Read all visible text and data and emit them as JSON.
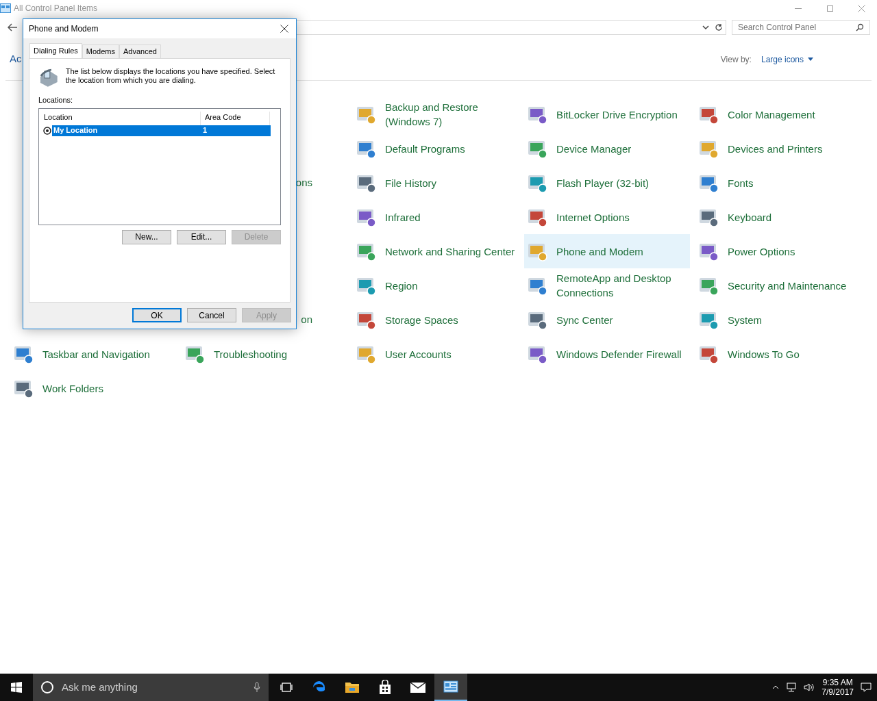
{
  "window": {
    "title": "All Control Panel Items",
    "search": {
      "placeholder": "Search Control Panel"
    },
    "heading": "Ac",
    "view_by": {
      "label": "View by:",
      "value": "Large icons"
    }
  },
  "rows": [
    [
      null,
      null,
      {
        "kind": "applet",
        "label": "Backup and Restore (Windows 7)",
        "highlighted": false
      },
      {
        "kind": "applet",
        "label": "BitLocker Drive Encryption",
        "highlighted": false
      },
      {
        "kind": "applet",
        "label": "Color Management",
        "highlighted": false
      }
    ],
    [
      null,
      null,
      {
        "kind": "applet",
        "label": "Default Programs",
        "highlighted": false
      },
      {
        "kind": "applet",
        "label": "Device Manager",
        "highlighted": false
      },
      {
        "kind": "applet",
        "label": "Devices and Printers",
        "highlighted": false
      }
    ],
    [
      null,
      {
        "kind": "clipped",
        "label": "ons"
      },
      {
        "kind": "applet",
        "label": "File History",
        "highlighted": false
      },
      {
        "kind": "applet",
        "label": "Flash Player (32-bit)",
        "highlighted": false
      },
      {
        "kind": "applet",
        "label": "Fonts",
        "highlighted": false
      }
    ],
    [
      null,
      null,
      {
        "kind": "applet",
        "label": "Infrared",
        "highlighted": false
      },
      {
        "kind": "applet",
        "label": "Internet Options",
        "highlighted": false
      },
      {
        "kind": "applet",
        "label": "Keyboard",
        "highlighted": false
      }
    ],
    [
      null,
      null,
      {
        "kind": "applet",
        "label": "Network and Sharing Center",
        "highlighted": false
      },
      {
        "kind": "applet",
        "label": "Phone and Modem",
        "highlighted": true
      },
      {
        "kind": "applet",
        "label": "Power Options",
        "highlighted": false
      }
    ],
    [
      null,
      null,
      {
        "kind": "applet",
        "label": "Region",
        "highlighted": false
      },
      {
        "kind": "applet",
        "label": "RemoteApp and Desktop Connections",
        "highlighted": false
      },
      {
        "kind": "applet",
        "label": "Security and Maintenance",
        "highlighted": false
      }
    ],
    [
      null,
      {
        "kind": "clipped",
        "label": "on"
      },
      {
        "kind": "applet",
        "label": "Storage Spaces",
        "highlighted": false
      },
      {
        "kind": "applet",
        "label": "Sync Center",
        "highlighted": false
      },
      {
        "kind": "applet",
        "label": "System",
        "highlighted": false
      }
    ],
    [
      {
        "kind": "applet",
        "label": "Taskbar and Navigation",
        "highlighted": false
      },
      {
        "kind": "applet",
        "label": "Troubleshooting",
        "highlighted": false
      },
      {
        "kind": "applet",
        "label": "User Accounts",
        "highlighted": false
      },
      {
        "kind": "applet",
        "label": "Windows Defender Firewall",
        "highlighted": false
      },
      {
        "kind": "applet",
        "label": "Windows To Go",
        "highlighted": false
      }
    ],
    [
      {
        "kind": "applet",
        "label": "Work Folders",
        "highlighted": false
      }
    ]
  ],
  "dialog": {
    "title": "Phone and Modem",
    "tabs": [
      {
        "label": "Dialing Rules",
        "selected": true
      },
      {
        "label": "Modems",
        "selected": false
      },
      {
        "label": "Advanced",
        "selected": false
      }
    ],
    "description": "The list below displays the locations you have specified. Select the location from which you are dialing.",
    "locations_label": "Locations:",
    "columns": [
      "Location",
      "Area Code"
    ],
    "locations": [
      {
        "location": "My Location",
        "area_code": "1",
        "selected": true
      }
    ],
    "list_buttons": [
      {
        "label": "New...",
        "disabled": false
      },
      {
        "label": "Edit...",
        "disabled": false
      },
      {
        "label": "Delete",
        "disabled": true
      }
    ],
    "footer_buttons": [
      {
        "label": "OK",
        "default": true,
        "disabled": false
      },
      {
        "label": "Cancel",
        "default": false,
        "disabled": false
      },
      {
        "label": "Apply",
        "default": false,
        "disabled": true
      }
    ]
  },
  "taskbar": {
    "search": {
      "placeholder": "Ask me anything"
    },
    "apps": [
      {
        "kind": "task-view",
        "active": false
      },
      {
        "kind": "browser",
        "active": false
      },
      {
        "kind": "folder",
        "active": false
      },
      {
        "kind": "store",
        "active": false
      },
      {
        "kind": "mail",
        "active": false
      },
      {
        "kind": "control-panel",
        "active": true
      }
    ],
    "time": "9:35 AM",
    "date": "7/9/2017"
  }
}
